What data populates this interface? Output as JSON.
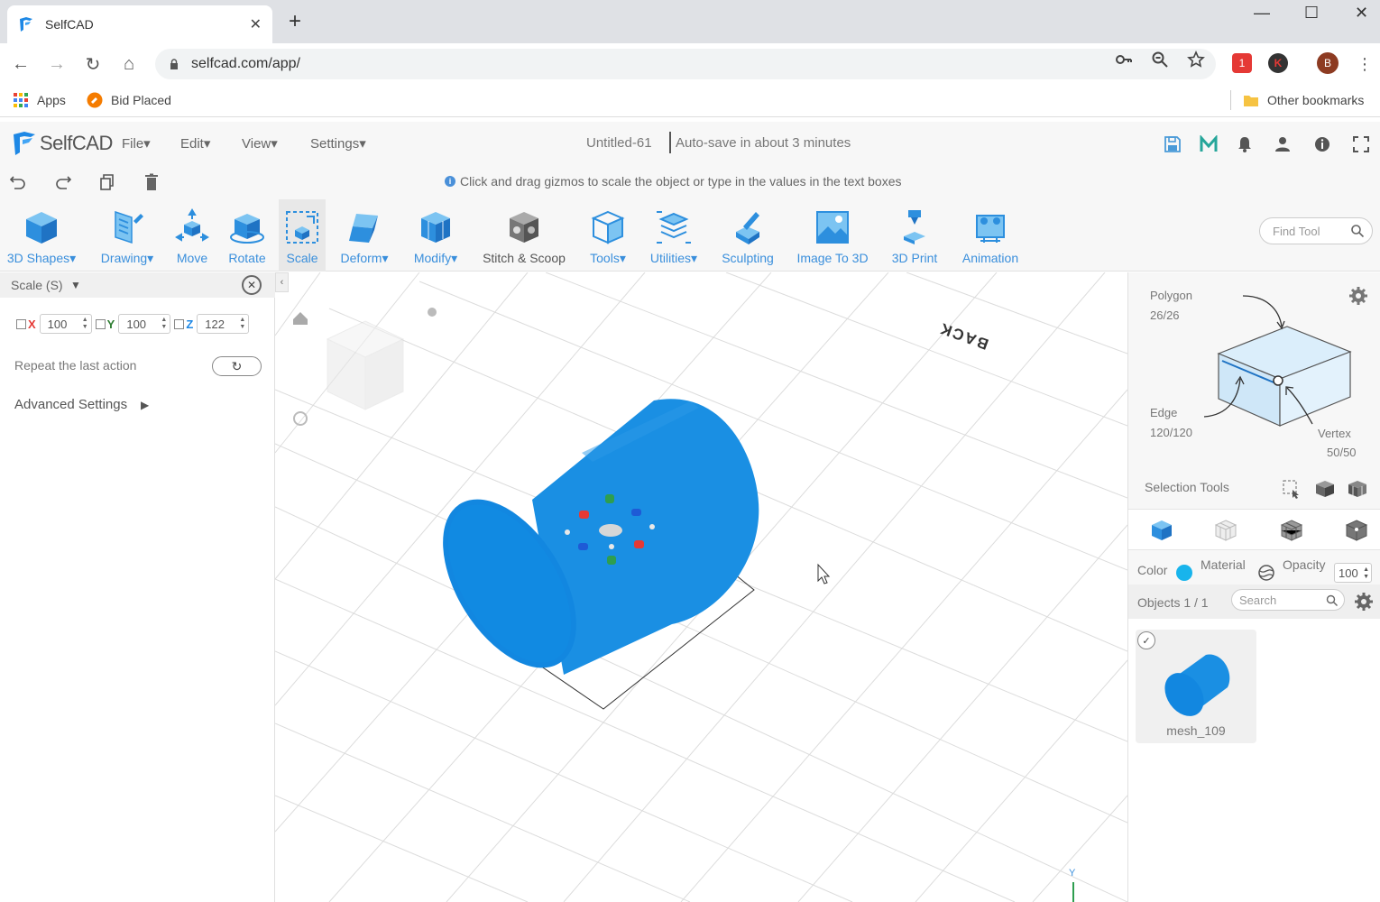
{
  "browser": {
    "tab_title": "SelfCAD",
    "url": "selfcad.com/app/",
    "profile_initial": "B",
    "ext_badge": "1",
    "ext_k": "K",
    "bookmarks": {
      "apps": "Apps",
      "bid": "Bid Placed",
      "other": "Other bookmarks"
    }
  },
  "app": {
    "logo": "SelfCAD",
    "menus": [
      "File",
      "Edit",
      "View",
      "Settings"
    ],
    "doc_title": "Untitled-61",
    "autosave": "Auto-save in about 3 minutes",
    "hint": "Click and drag gizmos to scale the object or type in the values in the text boxes"
  },
  "toolbar": {
    "tools": [
      {
        "label": "3D Shapes",
        "icon": "cube-icon",
        "dropdown": true
      },
      {
        "label": "Drawing",
        "icon": "drawing-icon",
        "dropdown": true
      },
      {
        "label": "Move",
        "icon": "move-icon"
      },
      {
        "label": "Rotate",
        "icon": "rotate-icon"
      },
      {
        "label": "Scale",
        "icon": "scale-icon",
        "active": true
      },
      {
        "label": "Deform",
        "icon": "deform-icon",
        "dropdown": true
      },
      {
        "label": "Modify",
        "icon": "modify-icon",
        "dropdown": true
      },
      {
        "label": "Stitch & Scoop",
        "icon": "stitch-scoop-icon"
      },
      {
        "label": "Tools",
        "icon": "tools-icon",
        "dropdown": true
      },
      {
        "label": "Utilities",
        "icon": "utilities-icon",
        "dropdown": true
      },
      {
        "label": "Sculpting",
        "icon": "sculpting-icon"
      },
      {
        "label": "Image To 3D",
        "icon": "image-to-3d-icon"
      },
      {
        "label": "3D Print",
        "icon": "3d-print-icon"
      },
      {
        "label": "Animation",
        "icon": "animation-icon"
      }
    ],
    "find_placeholder": "Find Tool"
  },
  "scale_panel": {
    "title": "Scale (S)",
    "x_label": "X",
    "x_value": "100",
    "y_label": "Y",
    "y_value": "100",
    "z_label": "Z",
    "z_value": "122",
    "repeat_label": "Repeat the last action",
    "advanced_label": "Advanced Settings"
  },
  "viewport": {
    "back_label": "BACK",
    "y_axis_label": "Y"
  },
  "selection": {
    "polygon_label": "Polygon",
    "polygon_count": "26/26",
    "edge_label": "Edge",
    "edge_count": "120/120",
    "vertex_label": "Vertex",
    "vertex_count": "50/50",
    "tools_label": "Selection Tools"
  },
  "properties": {
    "color_label": "Color",
    "color_value": "#18b4ec",
    "material_label": "Material",
    "opacity_label": "Opacity",
    "opacity_value": "100"
  },
  "objects": {
    "label": "Objects 1 / 1",
    "search_placeholder": "Search",
    "items": [
      {
        "name": "mesh_109"
      }
    ]
  },
  "colors": {
    "accent": "#3a8fdc",
    "object": "#1a8fe3"
  }
}
